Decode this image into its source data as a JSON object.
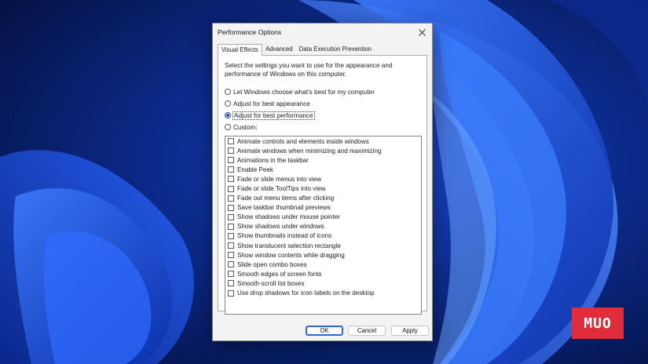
{
  "dialog": {
    "title": "Performance Options",
    "tabs": [
      {
        "label": "Visual Effects",
        "active": true
      },
      {
        "label": "Advanced",
        "active": false
      },
      {
        "label": "Data Execution Prevention",
        "active": false
      }
    ],
    "description": "Select the settings you want to use for the appearance and performance of Windows on this computer.",
    "radios": [
      {
        "label": "Let Windows choose what's best for my computer",
        "checked": false
      },
      {
        "label": "Adjust for best appearance",
        "checked": false
      },
      {
        "label": "Adjust for best performance",
        "checked": true
      },
      {
        "label": "Custom:",
        "checked": false
      }
    ],
    "effects": [
      {
        "label": "Animate controls and elements inside windows",
        "checked": false
      },
      {
        "label": "Animate windows when minimizing and maximizing",
        "checked": false
      },
      {
        "label": "Animations in the taskbar",
        "checked": false
      },
      {
        "label": "Enable Peek",
        "checked": false
      },
      {
        "label": "Fade or slide menus into view",
        "checked": false
      },
      {
        "label": "Fade or slide ToolTips into view",
        "checked": false
      },
      {
        "label": "Fade out menu items after clicking",
        "checked": false
      },
      {
        "label": "Save taskbar thumbnail previews",
        "checked": false
      },
      {
        "label": "Show shadows under mouse pointer",
        "checked": false
      },
      {
        "label": "Show shadows under windows",
        "checked": false
      },
      {
        "label": "Show thumbnails instead of icons",
        "checked": false
      },
      {
        "label": "Show translucent selection rectangle",
        "checked": false
      },
      {
        "label": "Show window contents while dragging",
        "checked": false
      },
      {
        "label": "Slide open combo boxes",
        "checked": false
      },
      {
        "label": "Smooth edges of screen fonts",
        "checked": false
      },
      {
        "label": "Smooth-scroll list boxes",
        "checked": false
      },
      {
        "label": "Use drop shadows for icon labels on the desktop",
        "checked": false
      }
    ],
    "buttons": {
      "ok": "OK",
      "cancel": "Cancel",
      "apply": "Apply"
    }
  },
  "watermark": {
    "text": "MUO",
    "color": "#e02d3c"
  },
  "colors": {
    "wallpaper": "#071a5c",
    "bloom": "#1f5cf0",
    "accent": "#1f4f9e"
  },
  "icons": {
    "close": "close-icon"
  }
}
